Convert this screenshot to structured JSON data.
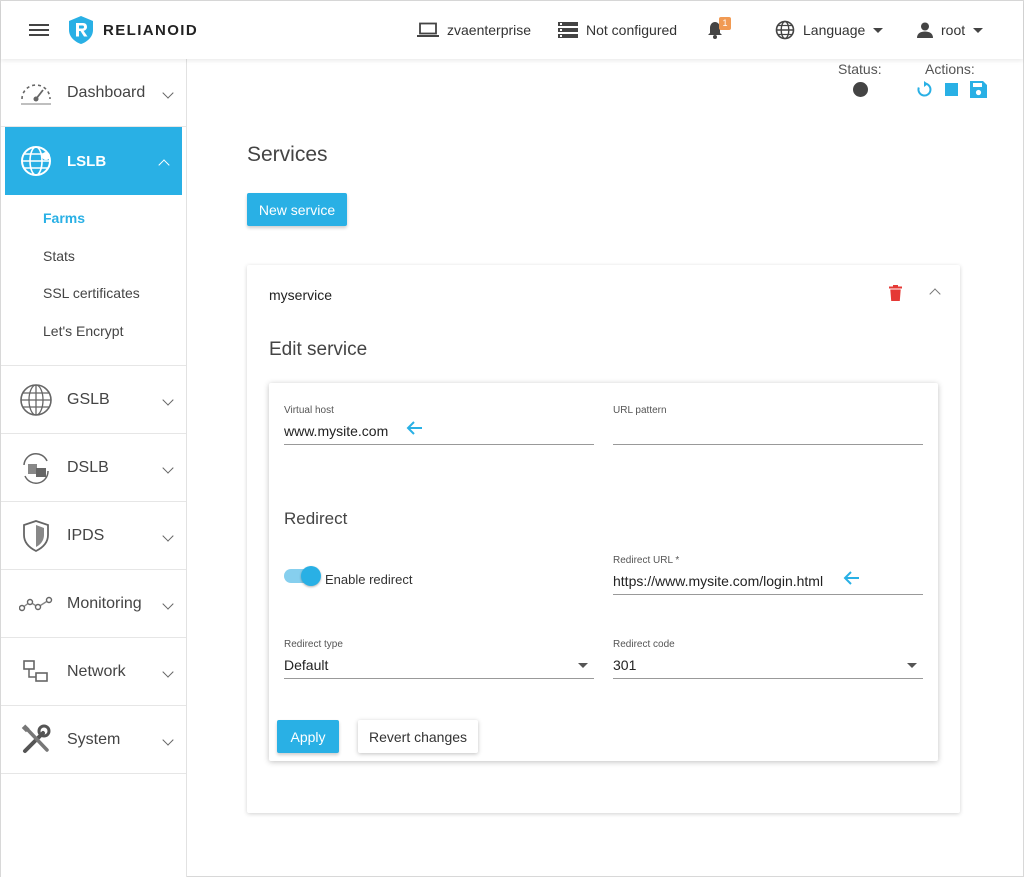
{
  "topbar": {
    "brand": "RELIANOID",
    "host": "zvaenterprise",
    "cluster": "Not configured",
    "notifications_count": "1",
    "language": "Language",
    "user": "root"
  },
  "sidebar": {
    "items": [
      {
        "label": "Dashboard",
        "icon": "dashboard-icon"
      },
      {
        "label": "LSLB",
        "icon": "globe-icon",
        "active": true
      },
      {
        "label": "GSLB",
        "icon": "globe-grid-icon"
      },
      {
        "label": "DSLB",
        "icon": "datacenter-icon"
      },
      {
        "label": "IPDS",
        "icon": "shield-icon"
      },
      {
        "label": "Monitoring",
        "icon": "monitoring-icon"
      },
      {
        "label": "Network",
        "icon": "network-icon"
      },
      {
        "label": "System",
        "icon": "tools-icon"
      }
    ],
    "lslb_sub": [
      "Farms",
      "Stats",
      "SSL certificates",
      "Let's Encrypt"
    ]
  },
  "status": {
    "label": "Status:",
    "actions_label": "Actions:"
  },
  "main": {
    "title": "Services",
    "new_service_label": "New service",
    "service_name": "myservice",
    "edit_title": "Edit service",
    "form": {
      "virtual_host_label": "Virtual host",
      "virtual_host_value": "www.mysite.com",
      "url_pattern_label": "URL pattern",
      "url_pattern_value": "",
      "redirect_section": "Redirect",
      "enable_redirect_label": "Enable redirect",
      "redirect_url_label": "Redirect URL *",
      "redirect_url_value": "https://www.mysite.com/login.html",
      "redirect_type_label": "Redirect type",
      "redirect_type_value": "Default",
      "redirect_code_label": "Redirect code",
      "redirect_code_value": "301",
      "apply_label": "Apply",
      "revert_label": "Revert changes"
    }
  },
  "colors": {
    "accent": "#29b0e5",
    "danger": "#e53935",
    "badge": "#f19a53"
  }
}
